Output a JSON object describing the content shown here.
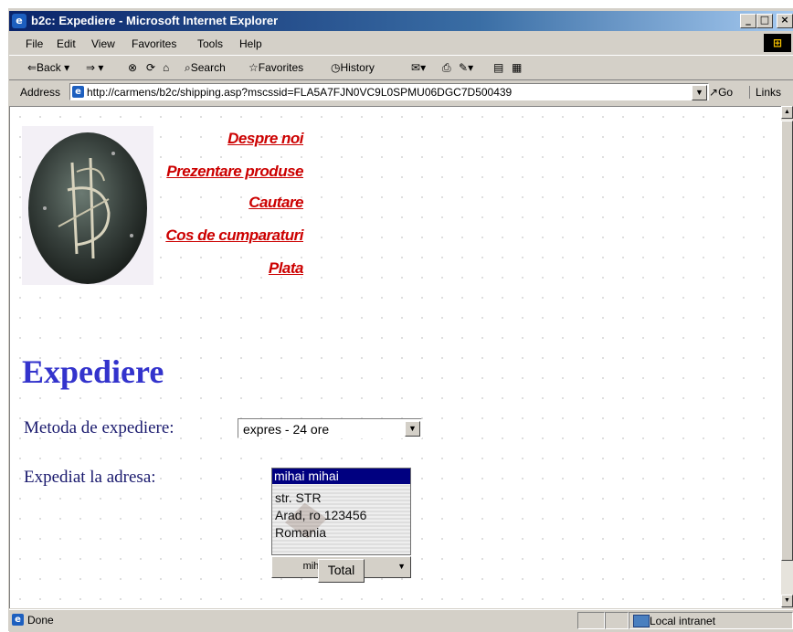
{
  "window": {
    "title": "b2c: Expediere - Microsoft Internet Explorer",
    "minimize": "_",
    "maximize": "□",
    "close": "×"
  },
  "menu": [
    "File",
    "Edit",
    "View",
    "Favorites",
    "Tools",
    "Help"
  ],
  "toolbar": {
    "back": "⇐Back ▾",
    "forward": "⇒ ▾",
    "stop": "⊗",
    "refresh": "⟳",
    "home": "⌂",
    "search": "Search",
    "favorites": "Favorites",
    "history": "History",
    "mail": "▾",
    "print": "⎙",
    "edit": "▾",
    "discuss": "▤",
    "messenger": "▦"
  },
  "address": {
    "label": "Address",
    "url": "http://carmens/b2c/shipping.asp?mscssid=FLA5A7FJN0VC9L0SPMU06DGC7D500439",
    "go": "Go",
    "links": "Links"
  },
  "nav": [
    {
      "label": "Despre noi"
    },
    {
      "label": "Prezentare produse"
    },
    {
      "label": "Cautare"
    },
    {
      "label": "Cos de cumparaturi"
    },
    {
      "label": "Plata"
    }
  ],
  "page": {
    "heading": "Expediere",
    "shipping_method_label": "Metoda de expediere:",
    "shipping_method_value": "expres - 24 ore",
    "ship_to_label": "Expediat la adresa:",
    "address": {
      "name": "mihai mihai",
      "street": "str. STR",
      "city": "Arad, ro 123456",
      "country": "Romania"
    },
    "address_select_value": "mihai - House",
    "total_button": "Total"
  },
  "status": {
    "text": "Done",
    "zone": "Local intranet"
  },
  "colors": {
    "nav_link": "#cc0000",
    "heading": "#3333cc",
    "label": "#1a1a6e",
    "selection": "#000080"
  }
}
